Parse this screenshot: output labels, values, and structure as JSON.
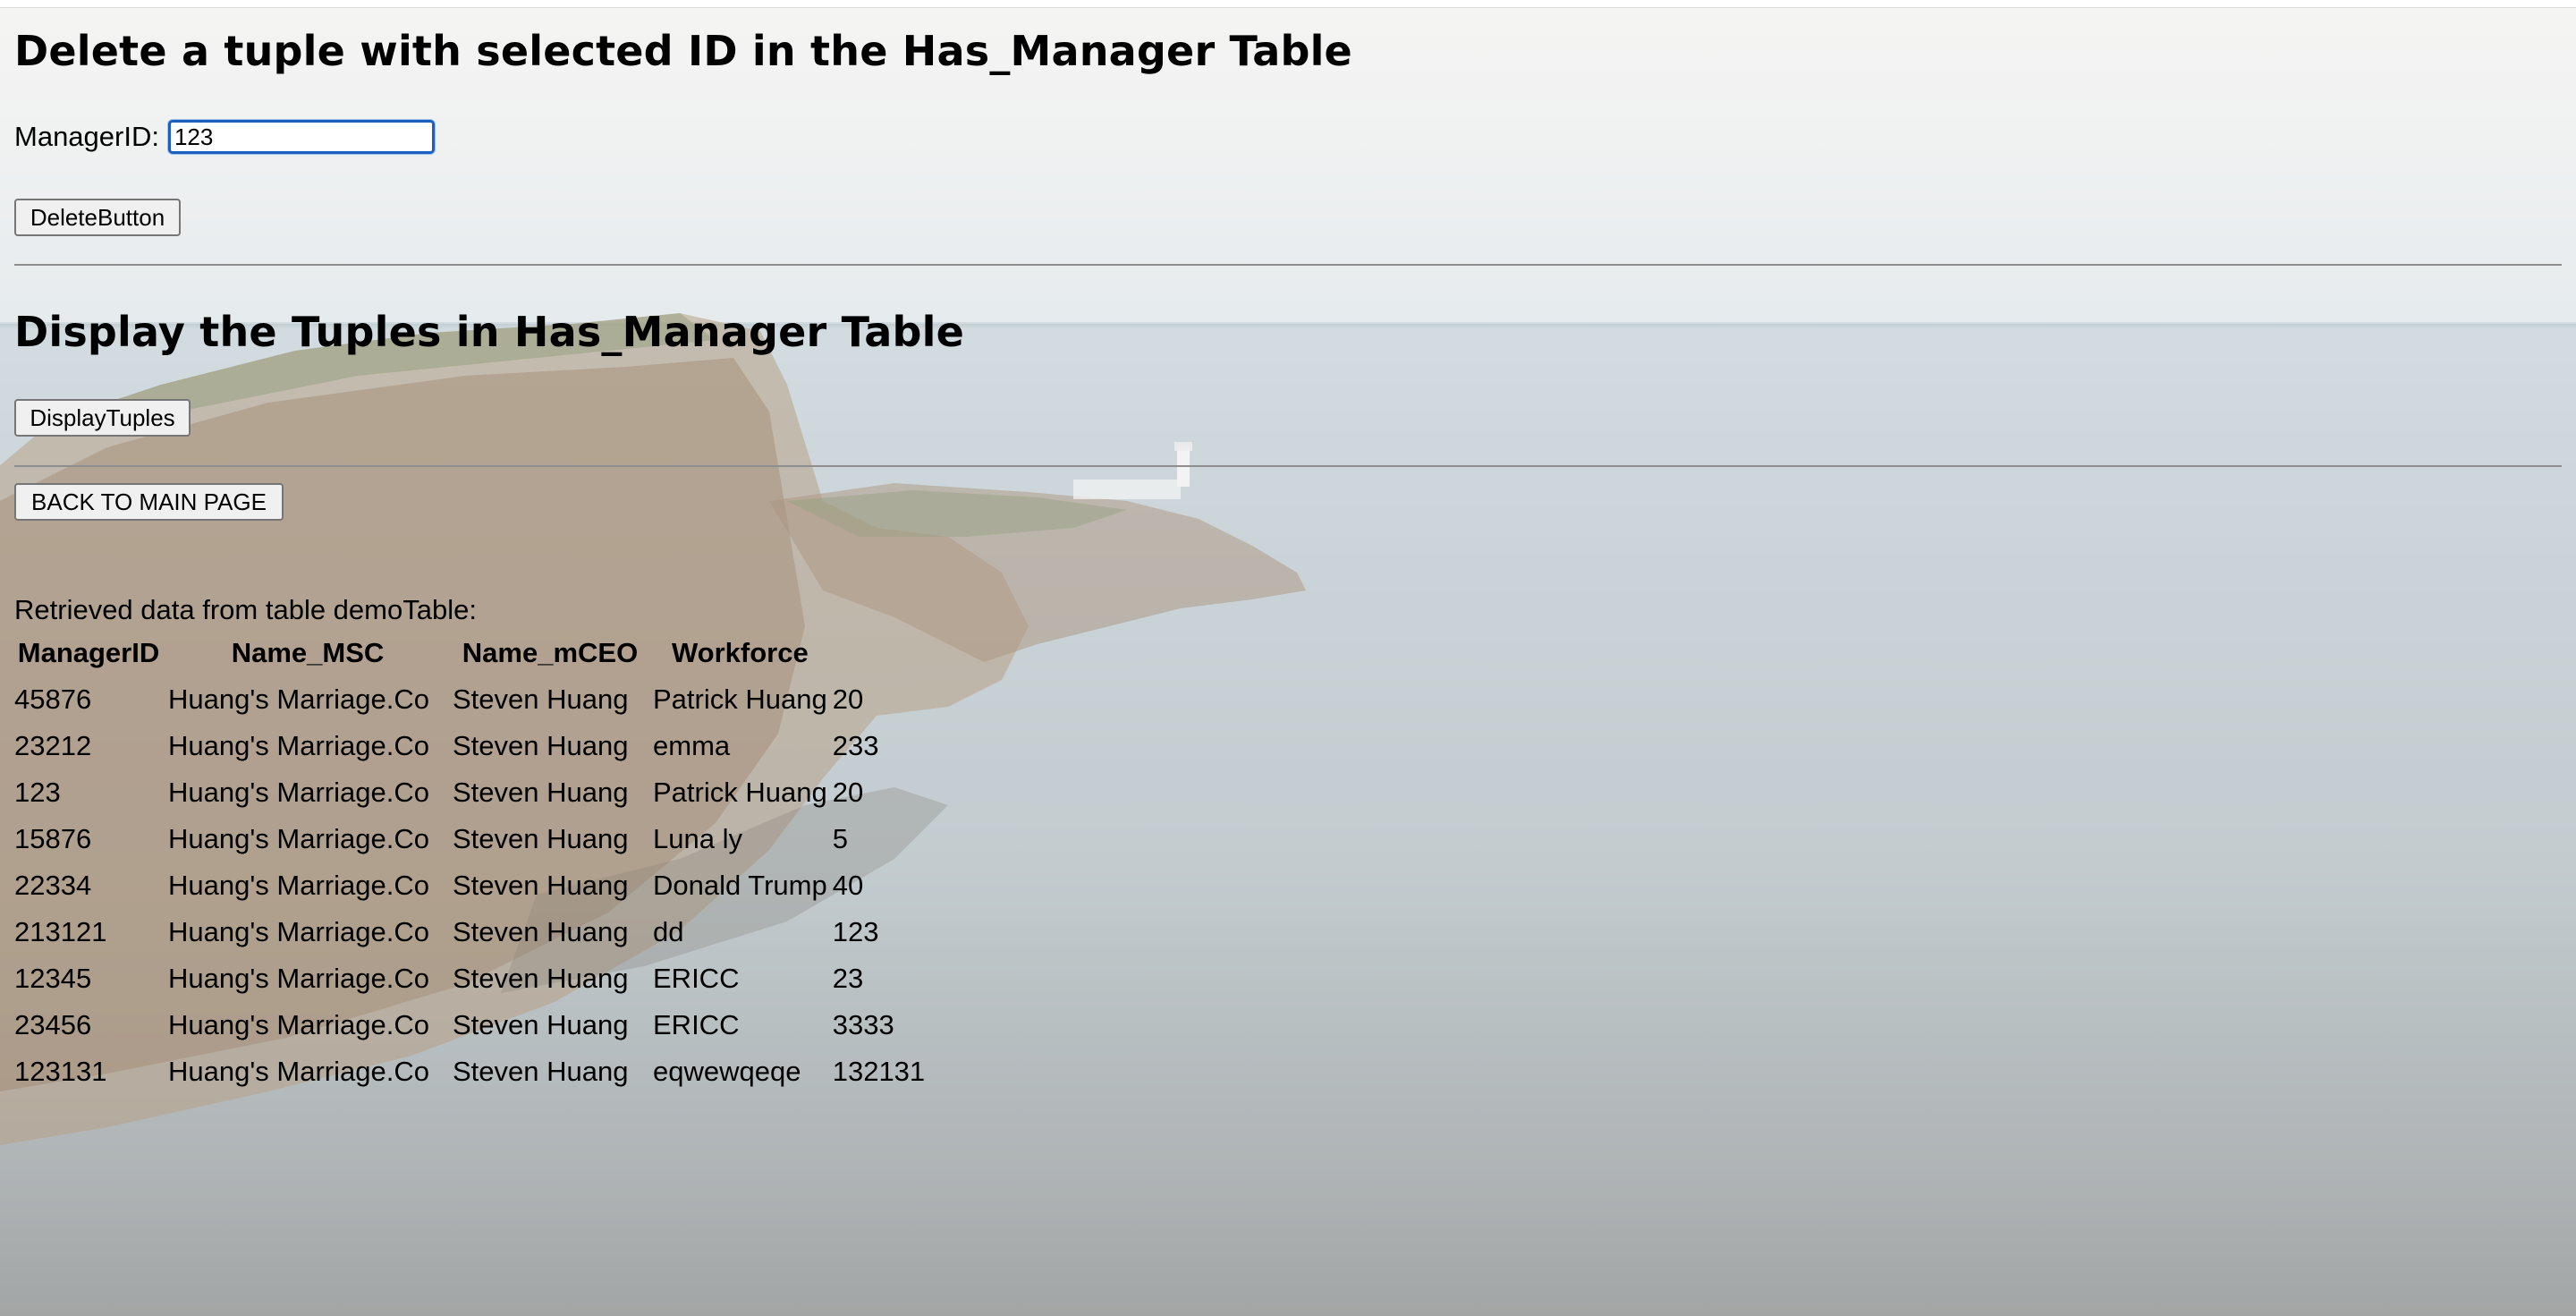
{
  "delete_section": {
    "heading": "Delete a tuple with selected ID in the Has_Manager Table",
    "label": "ManagerID:",
    "input_value": "123",
    "button_label": "DeleteButton"
  },
  "display_section": {
    "heading": "Display the Tuples in Has_Manager Table",
    "button_label": "DisplayTuples"
  },
  "back_button_label": "BACK TO MAIN PAGE",
  "retrieved_text": "Retrieved data from table demoTable:",
  "table": {
    "headers": [
      "ManagerID",
      "Name_MSC",
      "Name_mCEO",
      "Workforce"
    ],
    "rows": [
      [
        "45876",
        "Huang's Marriage.Co",
        "Steven Huang",
        "Patrick Huang",
        "20"
      ],
      [
        "23212",
        "Huang's Marriage.Co",
        "Steven Huang",
        "emma",
        "233"
      ],
      [
        "123",
        "Huang's Marriage.Co",
        "Steven Huang",
        "Patrick Huang",
        "20"
      ],
      [
        "15876",
        "Huang's Marriage.Co",
        "Steven Huang",
        "Luna ly",
        "5"
      ],
      [
        "22334",
        "Huang's Marriage.Co",
        "Steven Huang",
        "Donald Trump",
        "40"
      ],
      [
        "213121",
        "Huang's Marriage.Co",
        "Steven Huang",
        "dd",
        "123"
      ],
      [
        "12345",
        "Huang's Marriage.Co",
        "Steven Huang",
        "ERICC",
        "23"
      ],
      [
        "23456",
        "Huang's Marriage.Co",
        "Steven Huang",
        "ERICC",
        "3333"
      ],
      [
        "123131",
        "Huang's Marriage.Co",
        "Steven Huang",
        "eqwewqeqe",
        "132131"
      ]
    ]
  },
  "colors": {
    "input_focus_border": "#1b5fbf",
    "divider": "#8e8e8e",
    "button_bg": "#f0f0f0"
  }
}
